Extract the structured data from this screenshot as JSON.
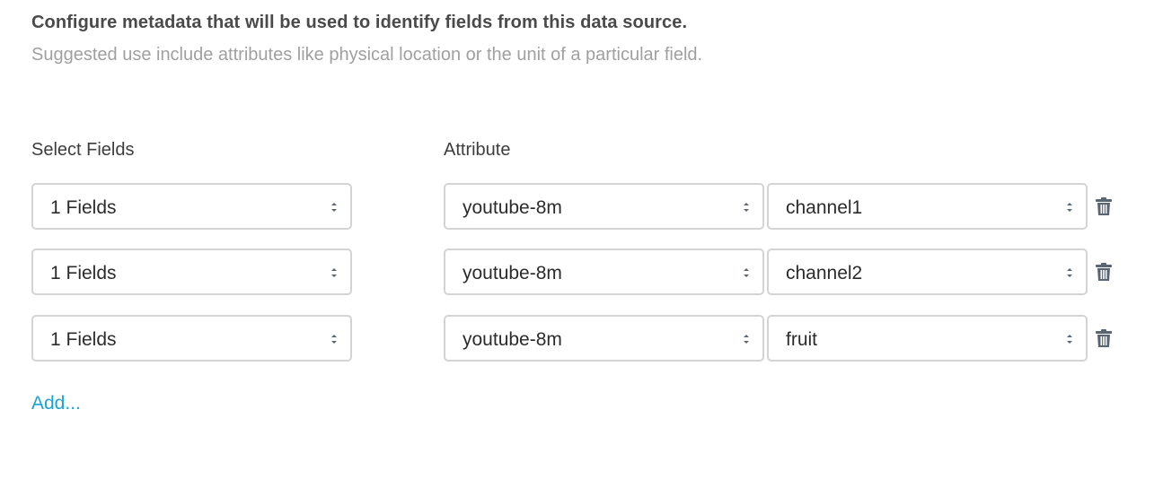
{
  "header": {
    "title": "Configure metadata that will be used to identify fields from this data source.",
    "subtitle": "Suggested use include attributes like physical location or the unit of a particular field."
  },
  "columns": {
    "fields_label": "Select Fields",
    "attribute_label": "Attribute"
  },
  "rows": [
    {
      "fields": "1 Fields",
      "source": "youtube-8m",
      "attribute": "channel1"
    },
    {
      "fields": "1 Fields",
      "source": "youtube-8m",
      "attribute": "channel2"
    },
    {
      "fields": "1 Fields",
      "source": "youtube-8m",
      "attribute": "fruit"
    }
  ],
  "add_label": "Add...",
  "icons": {
    "select_caret": "chevron-up-down-icon",
    "delete": "trash-icon"
  },
  "colors": {
    "link": "#1aa3d8",
    "icon": "#5a6573",
    "border": "#d4d4d4"
  }
}
